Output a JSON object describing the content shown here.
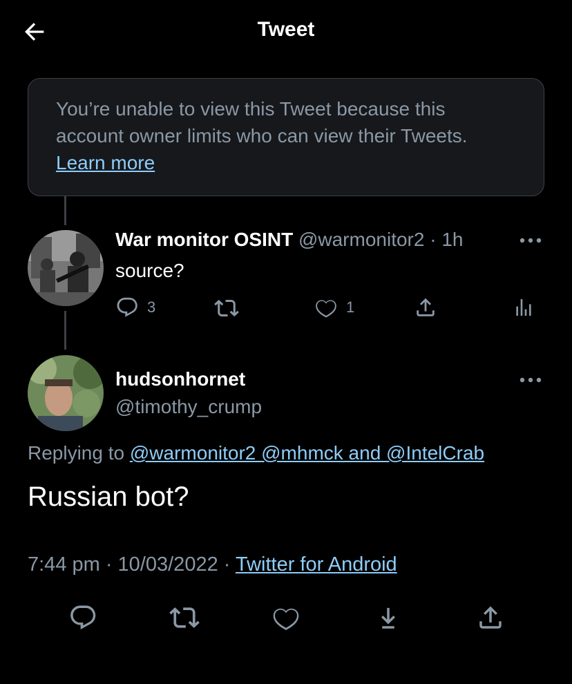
{
  "header": {
    "title": "Tweet",
    "back_icon": "arrow-left-icon"
  },
  "notice": {
    "text": "You’re unable to view this Tweet because this account owner limits who can view their Tweets.",
    "link": "Learn more"
  },
  "parent_tweet": {
    "name": "War monitor OSINT",
    "handle": "@warmonitor2",
    "sep": "·",
    "time": "1h",
    "text": "source?",
    "reply_count": "3",
    "like_count": "1"
  },
  "main_tweet": {
    "name": "hudsonhornet",
    "handle": "@timothy_crump",
    "replying_to_label": "Replying to",
    "replying_to_users": "@warmonitor2 @mhmck and @IntelCrab",
    "text": "Russian bot?",
    "timestamp": "7:44 pm · 10/03/2022 ·",
    "source": "Twitter for Android"
  },
  "colors": {
    "background": "#000000",
    "link": "#8ecdf8",
    "muted": "#8b98a5",
    "card": "#16181c"
  }
}
